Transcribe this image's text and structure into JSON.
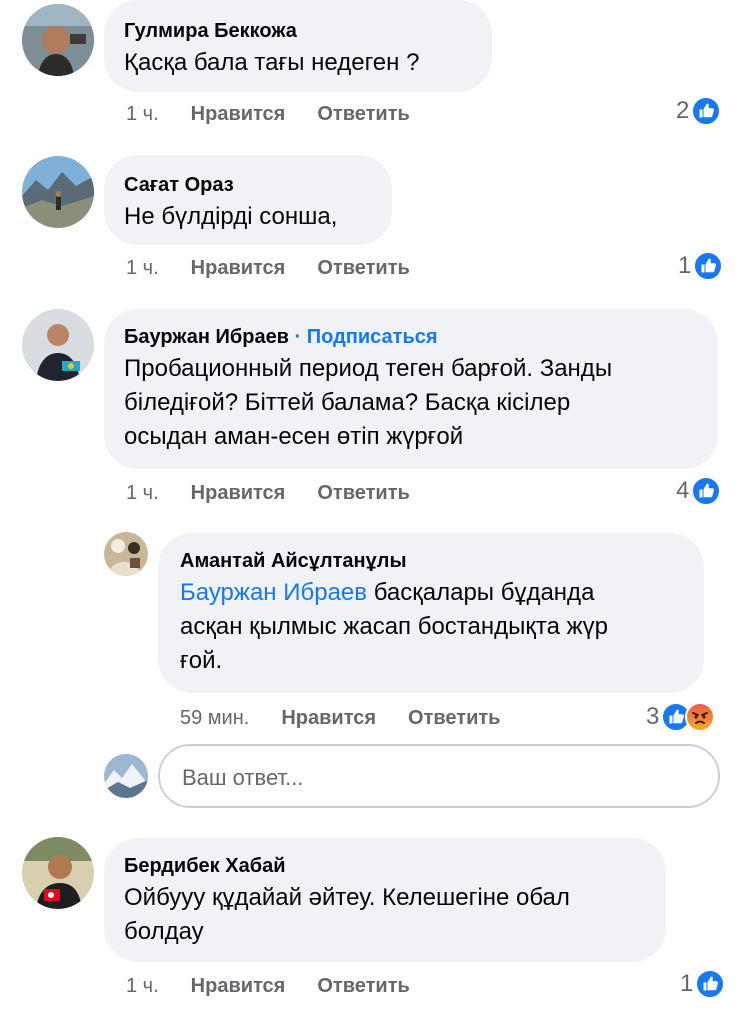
{
  "comments": [
    {
      "author": "Гулмира Беккожа",
      "text": "Қасқа бала тағы недеген ?",
      "time": "1 ч.",
      "like_label": "Нравится",
      "reply_label": "Ответить",
      "reactions": "2"
    },
    {
      "author": "Сағат Ораз",
      "text": "Не бүлдірді сонша,",
      "time": "1 ч.",
      "like_label": "Нравится",
      "reply_label": "Ответить",
      "reactions": "1"
    },
    {
      "author": "Бауржан Ибраев",
      "subscribe": "· Подписаться",
      "text_lines": [
        "Пробационный период теген барғой. Занды",
        "біледіғой? Біттей балама? Басқа кісілер",
        "осыдан аман-есен өтіп жүрғой"
      ],
      "time": "1 ч.",
      "like_label": "Нравится",
      "reply_label": "Ответить",
      "reactions": "4"
    },
    {
      "author": "Бердибек Хабай",
      "text_lines": [
        "Ойбууу құдайай әйтеу. Келешегіне обал",
        "болдау"
      ],
      "time": "1 ч.",
      "like_label": "Нравится",
      "reply_label": "Ответить",
      "reactions": "1"
    }
  ],
  "reply": {
    "author": "Амантай Айсұлтанұлы",
    "mention": "Бауржан Ибраев",
    "text_line1": " басқалары бұданда",
    "text_line2": "асқан қылмыс жасап бостандықта жүр",
    "text_line3": "ғой.",
    "time": "59 мин.",
    "like_label": "Нравится",
    "reply_label": "Ответить",
    "reactions": "3"
  },
  "reply_input": {
    "placeholder": "Ваш ответ..."
  },
  "colors": {
    "bubble": "#f0f2f5",
    "link": "#1877f2",
    "meta": "#65676b",
    "like": "#1877f2",
    "angry": "#f0564a"
  },
  "icons": [
    "like-icon",
    "angry-icon"
  ]
}
